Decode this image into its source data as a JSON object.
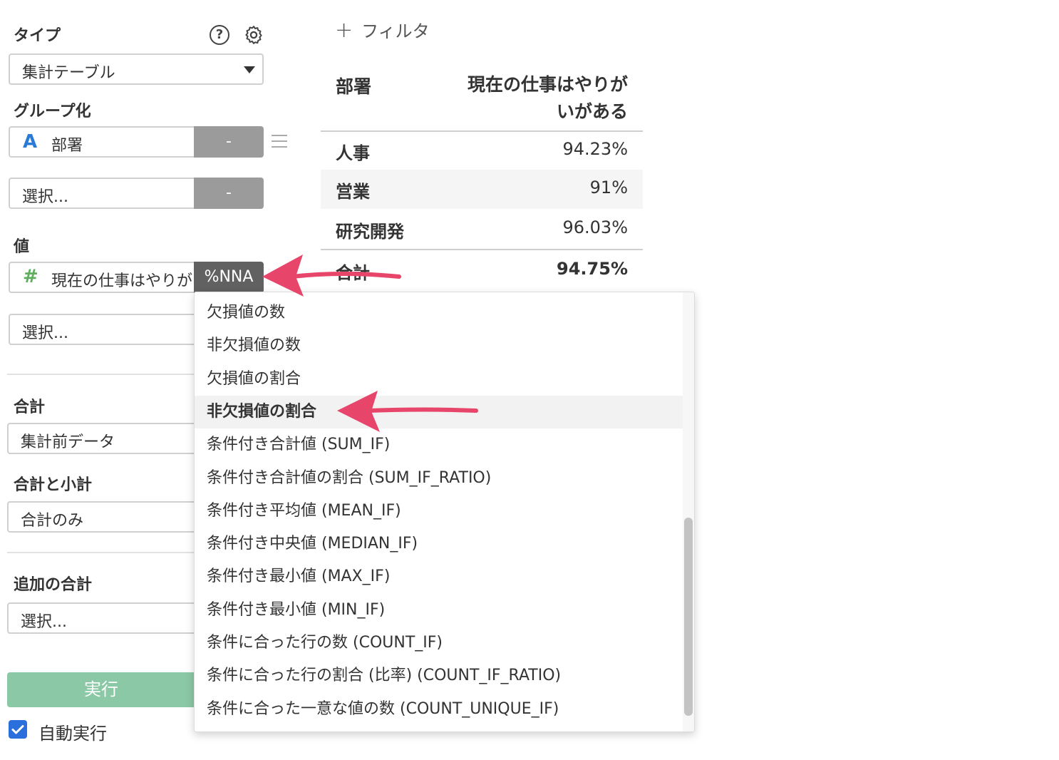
{
  "left_panel": {
    "type_label": "タイプ",
    "type_value": "集計テーブル",
    "group_label": "グループ化",
    "group_field_icon": "A",
    "group_field": "部署",
    "group_remove": "-",
    "group_select_placeholder": "選択...",
    "group_select_remove": "-",
    "value_label": "値",
    "value_field_icon": "#",
    "value_field": "現在の仕事はやりが",
    "value_aggregation": "%NNA",
    "value_select_placeholder": "選択...",
    "total_label": "合計",
    "total_value": "集計前データ",
    "subtotal_label": "合計と小計",
    "subtotal_value": "合計のみ",
    "extra_total_label": "追加の合計",
    "extra_total_placeholder": "選択...",
    "run_button": "実行",
    "auto_run_label": "自動実行",
    "auto_run_checked": true
  },
  "toolbar": {
    "add_filter": "フィルタ"
  },
  "table": {
    "headers": [
      "部署",
      "現在の仕事はやりが",
      "いがある"
    ],
    "rows": [
      {
        "dept": "人事",
        "value": "94.23%"
      },
      {
        "dept": "営業",
        "value": "91%"
      },
      {
        "dept": "研究開発",
        "value": "96.03%"
      }
    ],
    "total_label": "合計",
    "total_value": "94.75%"
  },
  "dropdown": {
    "items": [
      "欠損値の数",
      "非欠損値の数",
      "欠損値の割合",
      "非欠損値の割合",
      "条件付き合計値 (SUM_IF)",
      "条件付き合計値の割合 (SUM_IF_RATIO)",
      "条件付き平均値 (MEAN_IF)",
      "条件付き中央値 (MEDIAN_IF)",
      "条件付き最小値 (MAX_IF)",
      "条件付き最小値 (MIN_IF)",
      "条件に合った行の数 (COUNT_IF)",
      "条件に合った行の割合 (比率) (COUNT_IF_RATIO)",
      "条件に合った一意な値の数 (COUNT_UNIQUE_IF)"
    ],
    "highlighted_index": 3
  },
  "colors": {
    "accent_arrow": "#e8456b",
    "run_button": "#8bc8a5",
    "checkbox": "#2a6fdb",
    "group_icon": "#2a7bd6",
    "value_icon": "#5fae5f",
    "aggregation_badge": "#616161"
  }
}
